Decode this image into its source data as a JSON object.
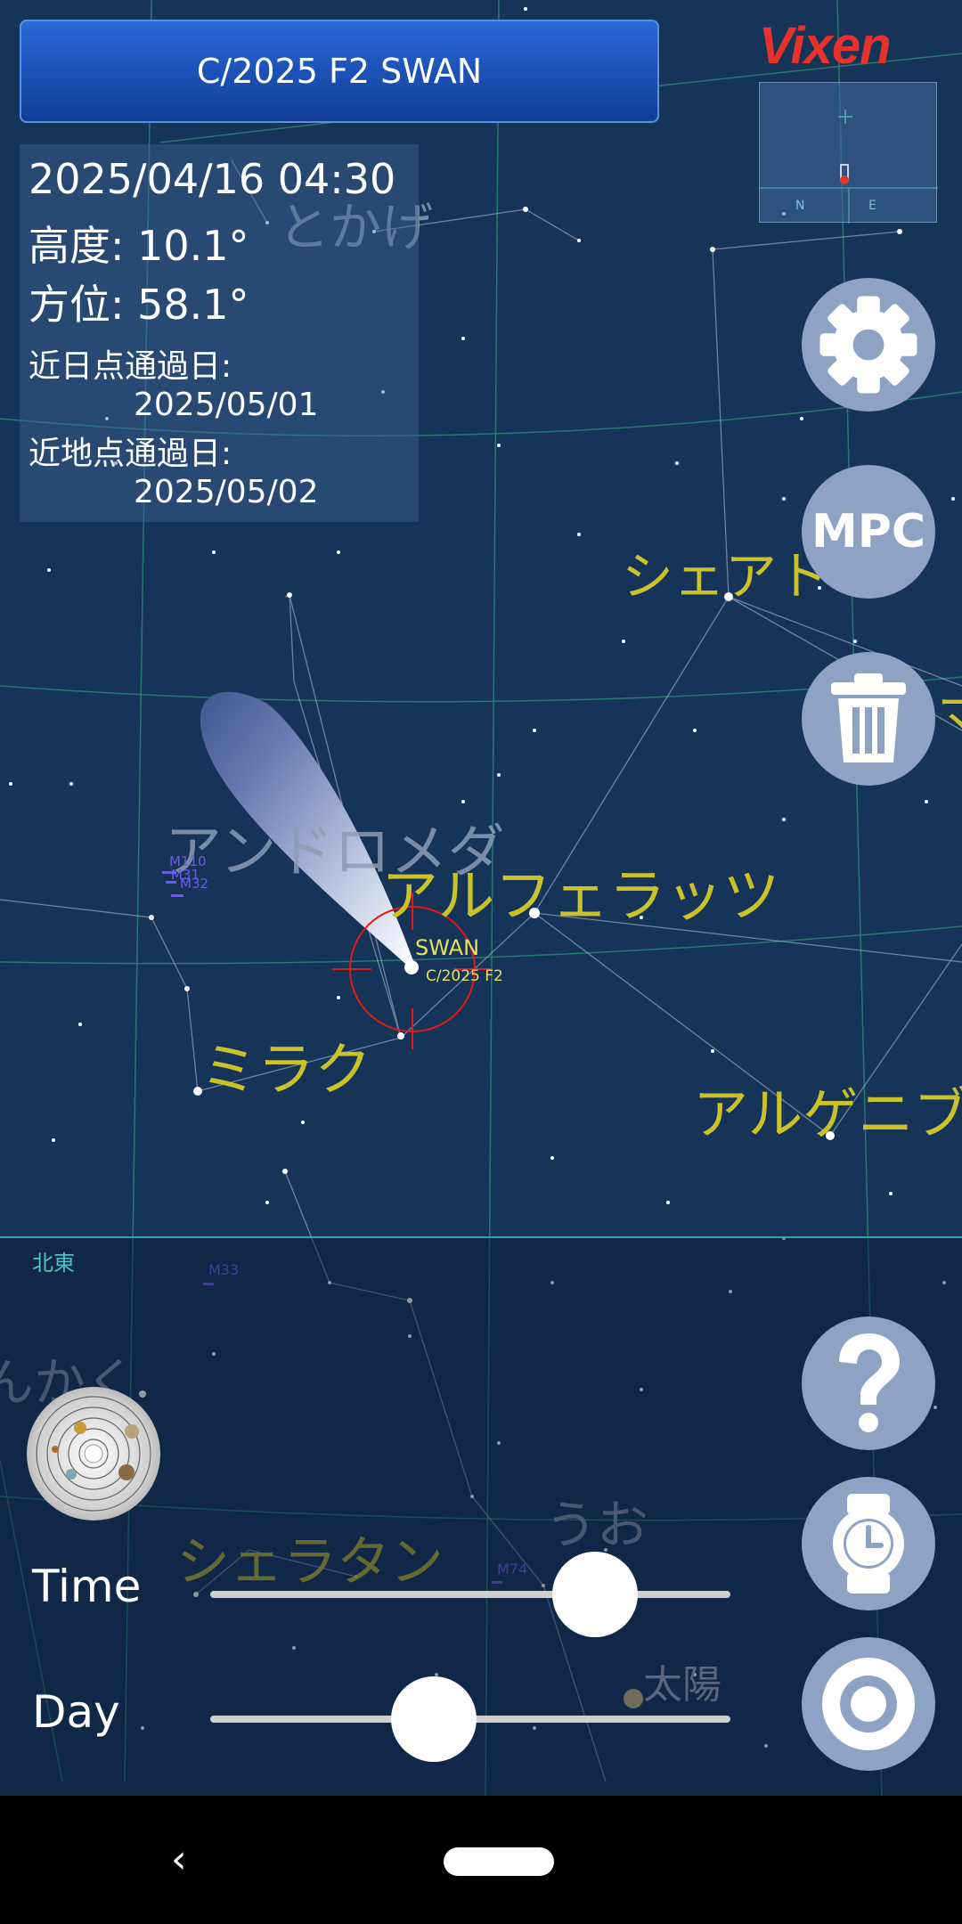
{
  "header": {
    "object_name": "C/2025 F2 SWAN"
  },
  "info": {
    "datetime": "2025/04/16 04:30",
    "altitude": "高度: 10.1°",
    "azimuth": "方位: 58.1°",
    "perihelion_label": "近日点通過日:",
    "perihelion_date": "2025/05/01",
    "perigee_label": "近地点通過日:",
    "perigee_date": "2025/05/02"
  },
  "brand": {
    "logo_text": "Vixen"
  },
  "minimap": {
    "n": "N",
    "e": "E"
  },
  "buttons": {
    "mpc_label": "MPC"
  },
  "sky_labels": {
    "tokage": "とかげ",
    "andromeda": "アンドロメダ",
    "scheat": "シェアト",
    "ma": "マ",
    "alpheratz": "アルフェラッツ",
    "mirach": "ミラク",
    "algenib": "アルゲニブ",
    "swan": "SWAN",
    "comet_id": "C/2025 F2",
    "uo": "うお",
    "sun": "太陽",
    "sheratan": "シェラタン",
    "kaku": "んかく",
    "m110": "M110",
    "m31": "M31",
    "m32": "M32",
    "m33": "M33",
    "m74": "M74"
  },
  "compass": {
    "direction": "北東"
  },
  "controls": {
    "time_label": "Time",
    "day_label": "Day",
    "time_value": 0.74,
    "day_value": 0.43
  },
  "colors": {
    "sky": "#163458",
    "yellow_label": "#c9c22a",
    "grey_label": "#8c9db5",
    "button": "#8ea3c4",
    "crosshair": "#e01a1a"
  }
}
